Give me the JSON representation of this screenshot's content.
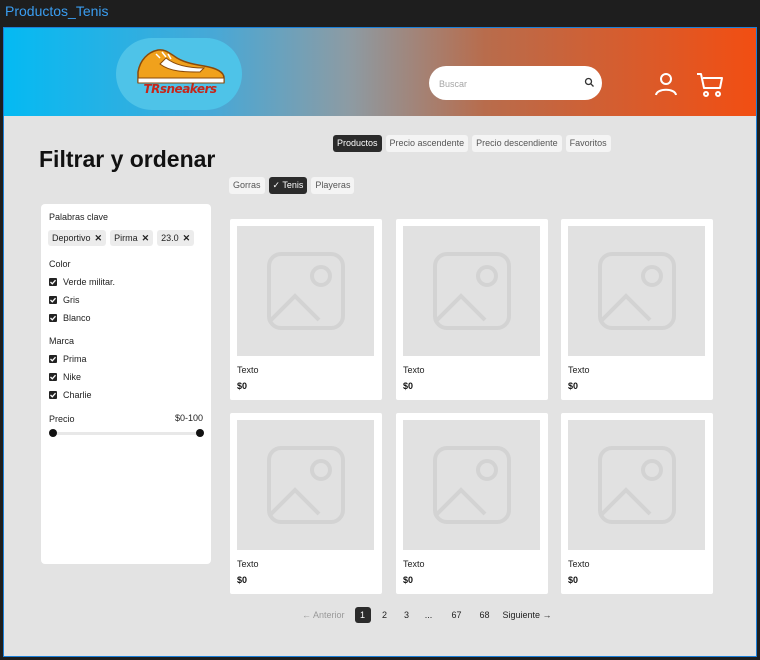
{
  "window": {
    "title": "Productos_Tenis"
  },
  "header": {
    "logo_text": "TRsneakers",
    "search_placeholder": "Buscar",
    "colors": {
      "gradient_start": "#04baf3",
      "gradient_end": "#f24e12"
    }
  },
  "page": {
    "title": "Filtrar y ordenar"
  },
  "sort_tabs": [
    "Productos",
    "Precio ascendente",
    "Precio descendiente",
    "Favoritos"
  ],
  "sort_active_index": 0,
  "categories": [
    "Gorras",
    "Tenis",
    "Playeras"
  ],
  "category_active_index": 1,
  "filters": {
    "keywords_label": "Palabras clave",
    "keywords": [
      "Deportivo",
      "Pirma",
      "23.0"
    ],
    "color_label": "Color",
    "colors": [
      "Verde militar.",
      "Gris",
      "Blanco"
    ],
    "brand_label": "Marca",
    "brands": [
      "Prima",
      "Nike",
      "Charlie"
    ],
    "price_label": "Precio",
    "price_range": "$0-100"
  },
  "products": [
    {
      "name": "Texto",
      "price": "$0"
    },
    {
      "name": "Texto",
      "price": "$0"
    },
    {
      "name": "Texto",
      "price": "$0"
    },
    {
      "name": "Texto",
      "price": "$0"
    },
    {
      "name": "Texto",
      "price": "$0"
    },
    {
      "name": "Texto",
      "price": "$0"
    }
  ],
  "pagination": {
    "prev": "Anterior",
    "pages": [
      "1",
      "2",
      "3",
      "...",
      "67",
      "68"
    ],
    "current": "1",
    "next": "Siguiente"
  }
}
